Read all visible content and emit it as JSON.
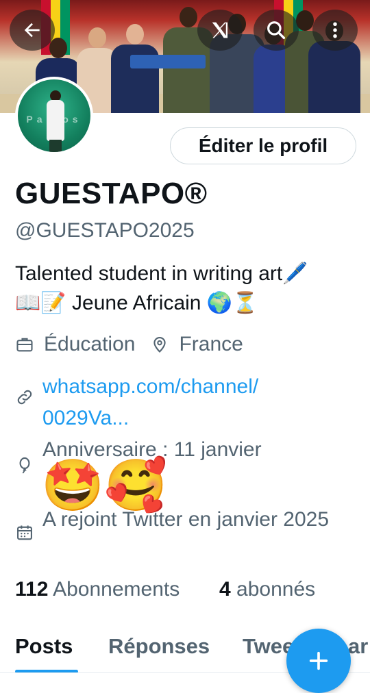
{
  "profile": {
    "name": "GUESTAPO®",
    "handle": "@GUESTAPO2025",
    "bio_line1": "Talented student in writing art🖊️",
    "bio_line2": "📖📝 Jeune Africain 🌍⏳",
    "category": "Éducation",
    "location": "France",
    "link_line1": "whatsapp.com/channel/",
    "link_line2": "0029Va...",
    "birthday": "Anniversaire : 11 janvier",
    "birthday_emojis": "🤩🥰",
    "joined": "A rejoint Twitter en janvier 2025",
    "avatar_text": "Pa     yos"
  },
  "actions": {
    "edit_profile": "Éditer le profil"
  },
  "stats": {
    "following_count": "112",
    "following_label": "Abonnements",
    "followers_count": "4",
    "followers_label": "abonnés"
  },
  "tabs": [
    "Posts",
    "Réponses",
    "Twee",
    "ar"
  ],
  "colors": {
    "accent": "#1d9bf0",
    "text": "#0f1419",
    "muted": "#536471"
  }
}
